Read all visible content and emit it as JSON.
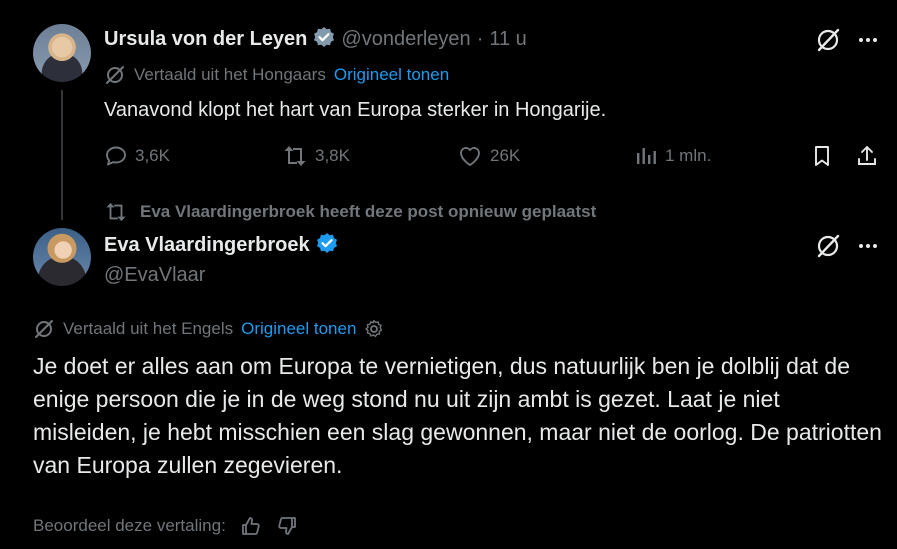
{
  "tweet1": {
    "name": "Ursula von der Leyen",
    "handle": "@vonderleyen",
    "time": "11 u",
    "translated_from": "Vertaald uit het Hongaars",
    "show_original": "Origineel tonen",
    "text": "Vanavond klopt het hart van Europa sterker in Hongarije.",
    "replies": "3,6K",
    "reposts": "3,8K",
    "likes": "26K",
    "views": "1 mln."
  },
  "repost_banner": "Eva Vlaardingerbroek heeft deze post opnieuw geplaatst",
  "tweet2": {
    "name": "Eva Vlaardingerbroek",
    "handle": "@EvaVlaar",
    "translated_from": "Vertaald uit het Engels",
    "show_original": "Origineel tonen",
    "text": "Je doet er alles aan om Europa te vernietigen, dus natuurlijk ben je dolblij dat de enige persoon die je in de weg stond nu uit zijn ambt is gezet. Laat je niet misleiden, je hebt misschien een slag gewonnen, maar niet de oorlog. De patriotten van Europa zullen zegevieren.",
    "rate_translation": "Beoordeel deze vertaling:"
  },
  "colors": {
    "background": "#000000",
    "text": "#e7e9ea",
    "muted": "#71767b",
    "accent": "#1d9bf0"
  }
}
